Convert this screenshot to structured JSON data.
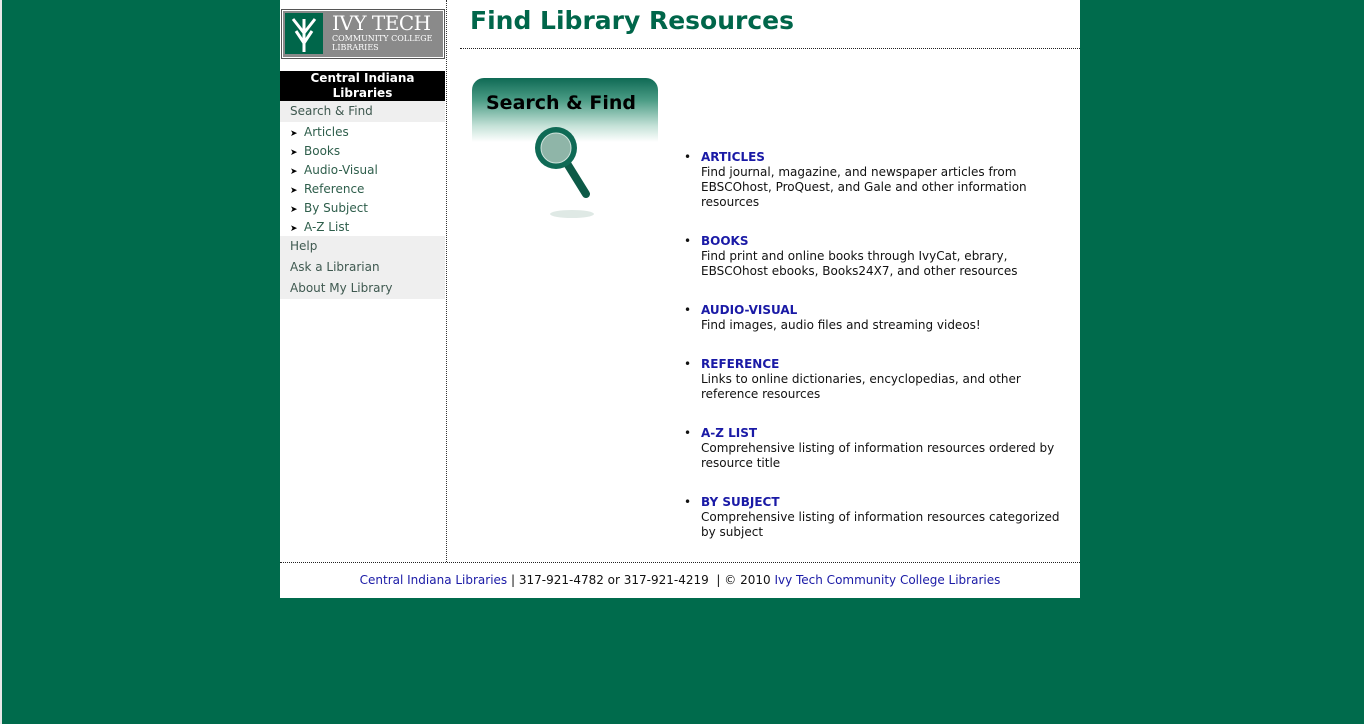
{
  "colors": {
    "background": "#006b4c",
    "accent": "#00664a",
    "link": "#1a1aa6"
  },
  "logo": {
    "title": "IVY TECH",
    "sub1": "COMMUNITY COLLEGE",
    "sub2": "LIBRARIES"
  },
  "sidebar": {
    "site_line1": "Central Indiana",
    "site_line2": "Libraries",
    "search_find": "Search & Find",
    "subitems": [
      "Articles",
      "Books",
      "Audio-Visual",
      "Reference",
      "By Subject",
      "A-Z List"
    ],
    "help": "Help",
    "ask": "Ask a Librarian",
    "about": "About My Library"
  },
  "main": {
    "title": "Find Library Resources",
    "banner_text": "Search & Find",
    "resources": [
      {
        "label": "ARTICLES",
        "desc": "Find journal, magazine, and newspaper articles from EBSCOhost, ProQuest, and Gale and other information resources"
      },
      {
        "label": "BOOKS",
        "desc": "Find print and online books through IvyCat, ebrary, EBSCOhost ebooks, Books24X7, and other resources"
      },
      {
        "label": "AUDIO-VISUAL",
        "desc": "Find images, audio files and streaming videos!"
      },
      {
        "label": "REFERENCE",
        "desc": "Links to online dictionaries, encyclopedias, and other reference resources"
      },
      {
        "label": "A-Z LIST",
        "desc": "Comprehensive listing of information resources ordered by resource title"
      },
      {
        "label": "BY SUBJECT",
        "desc": "Comprehensive listing of information resources categorized by subject"
      }
    ]
  },
  "footer": {
    "org_link": "Central Indiana Libraries",
    "phones": " | 317-921-4782 or 317-921-4219  | © 2010 ",
    "college_link": "Ivy Tech Community College Libraries"
  }
}
